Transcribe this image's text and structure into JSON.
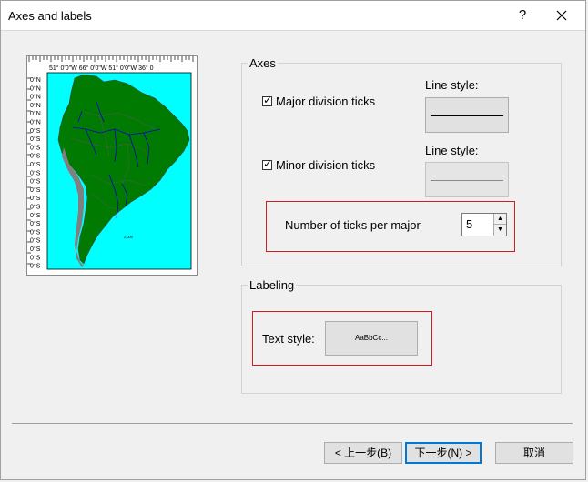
{
  "window": {
    "title": "Axes and labels",
    "help_label": "?"
  },
  "map": {
    "top_ticks": "51° 0'0\"W 66° 0'0\"W 51° 0'0\"W 36° 0",
    "left_ticks": [
      "0°N",
      "0°N",
      "0°N",
      "0°N",
      "0°N",
      "0°N",
      "0°S",
      "0°S",
      "0°S",
      "0°S",
      "0°S",
      "0°S",
      "0°S",
      "0°S",
      "0°S",
      "0°S",
      "0°S",
      "0°S",
      "0°S",
      "0°S",
      "0°S",
      "0°S",
      "0°S"
    ],
    "scale_label": "2,000",
    "colors": {
      "ocean": "#00ffff",
      "land": "#007a00",
      "rivers": "#0000cc",
      "andes": "#808080"
    }
  },
  "axes": {
    "legend": "Axes",
    "major": {
      "checked": true,
      "label": "Major division ticks",
      "line_style_label": "Line style:"
    },
    "minor": {
      "checked": true,
      "label": "Minor division ticks",
      "line_style_label": "Line style:"
    },
    "ticks": {
      "label": "Number of ticks per major",
      "value": "5"
    }
  },
  "labeling": {
    "legend": "Labeling",
    "text_style_label": "Text style:",
    "text_style_sample": "AaBbCc..."
  },
  "buttons": {
    "back": "< 上一步(B)",
    "next": "下一步(N) >",
    "cancel": "取消"
  }
}
